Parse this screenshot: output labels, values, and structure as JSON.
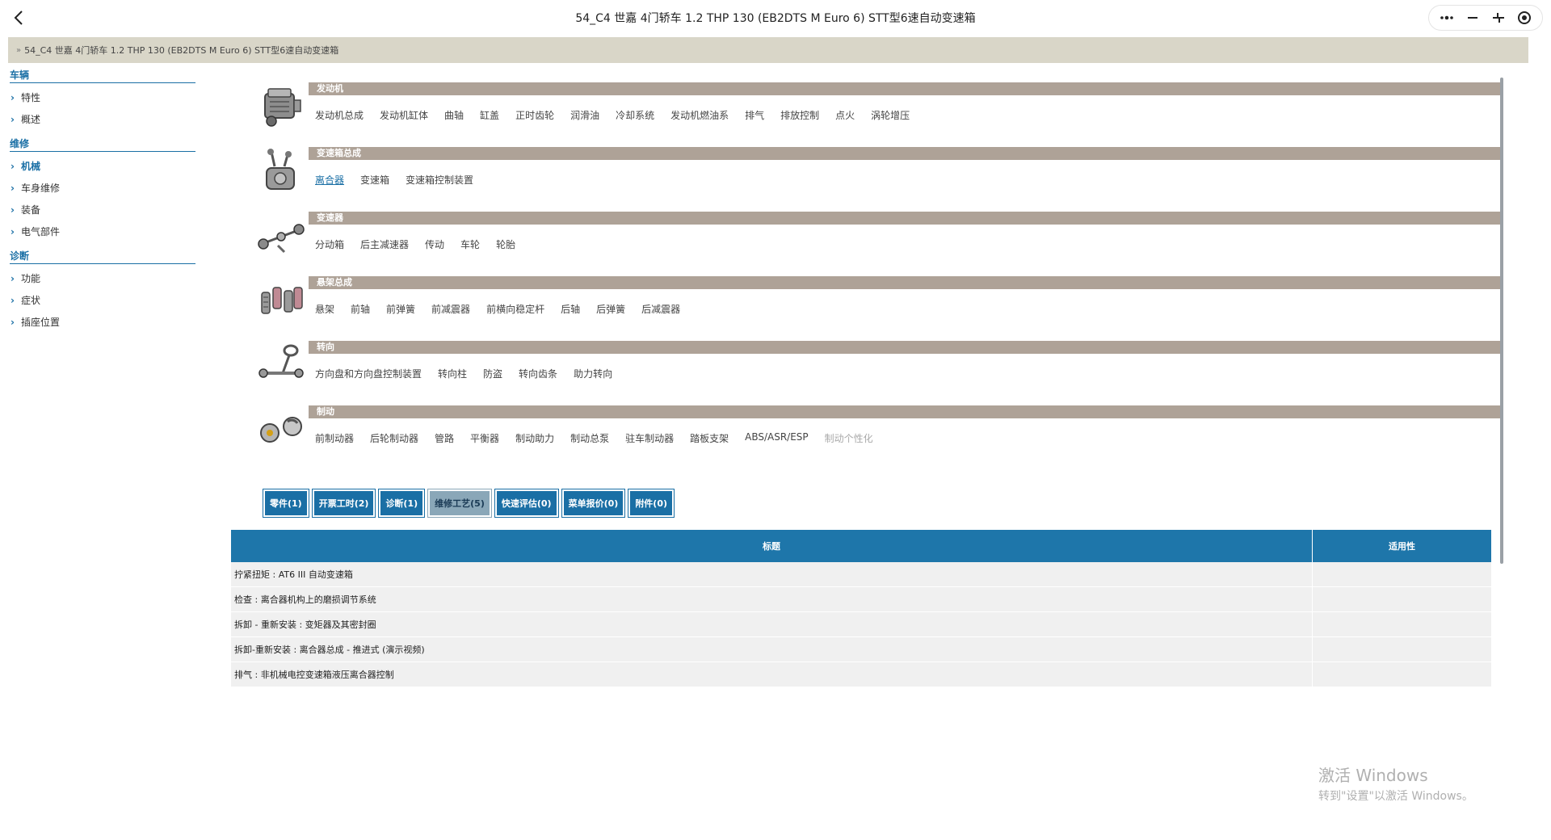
{
  "window": {
    "title": "54_C4 世嘉 4门轿车 1.2 THP 130 (EB2DTS M Euro 6) STT型6速自动变速箱"
  },
  "breadcrumb": {
    "arrow": "»",
    "text": "54_C4 世嘉 4门轿车 1.2 THP 130 (EB2DTS M Euro 6) STT型6速自动变速箱"
  },
  "sidebar": {
    "sections": [
      {
        "header": "车辆",
        "items": [
          "特性",
          "概述"
        ]
      },
      {
        "header": "维修",
        "items": [
          "机械",
          "车身维修",
          "装备",
          "电气部件"
        ]
      },
      {
        "header": "诊断",
        "items": [
          "功能",
          "症状",
          "插座位置"
        ]
      }
    ]
  },
  "categories": [
    {
      "name": "发动机",
      "icon": "engine-icon",
      "links": [
        "发动机总成",
        "发动机缸体",
        "曲轴",
        "缸盖",
        "正时齿轮",
        "润滑油",
        "冷却系统",
        "发动机燃油系",
        "排气",
        "排放控制",
        "点火",
        "涡轮增压"
      ]
    },
    {
      "name": "变速箱总成",
      "icon": "gearbox-icon",
      "links": [
        "离合器",
        "变速箱",
        "变速箱控制装置"
      ]
    },
    {
      "name": "变速器",
      "icon": "driveshaft-icon",
      "links": [
        "分动箱",
        "后主减速器",
        "传动",
        "车轮",
        "轮胎"
      ]
    },
    {
      "name": "悬架总成",
      "icon": "suspension-icon",
      "links": [
        "悬架",
        "前轴",
        "前弹簧",
        "前减震器",
        "前横向稳定杆",
        "后轴",
        "后弹簧",
        "后减震器"
      ]
    },
    {
      "name": "转向",
      "icon": "steering-icon",
      "links": [
        "方向盘和方向盘控制装置",
        "转向柱",
        "防盗",
        "转向齿条",
        "助力转向"
      ]
    },
    {
      "name": "制动",
      "icon": "brake-icon",
      "links": [
        "前制动器",
        "后轮制动器",
        "管路",
        "平衡器",
        "制动助力",
        "制动总泵",
        "驻车制动器",
        "踏板支架",
        "ABS/ASR/ESP",
        "制动个性化"
      ]
    }
  ],
  "tabs": [
    "零件(1)",
    "开票工时(2)",
    "诊断(1)",
    "维修工艺(5)",
    "快速评估(0)",
    "菜单报价(0)",
    "附件(0)"
  ],
  "table": {
    "headers": {
      "title": "标题",
      "applicability": "适用性"
    },
    "rows": [
      "拧紧扭矩 : AT6 III 自动变速箱",
      "检查 : 离合器机构上的磨损调节系统",
      "拆卸 - 重新安装 : 变矩器及其密封圈",
      "拆卸-重新安装 : 离合器总成 - 推进式 (演示视频)",
      "排气 : 非机械电控变速箱液压离合器控制"
    ]
  },
  "watermark": {
    "title": "激活 Windows",
    "subtitle": "转到\"设置\"以激活 Windows。"
  },
  "colors": {
    "accent": "#1a6fa5",
    "category_bar": "#aea297",
    "breadcrumb_bg": "#d9d6c8",
    "active_tab": "#8aa7b8"
  }
}
